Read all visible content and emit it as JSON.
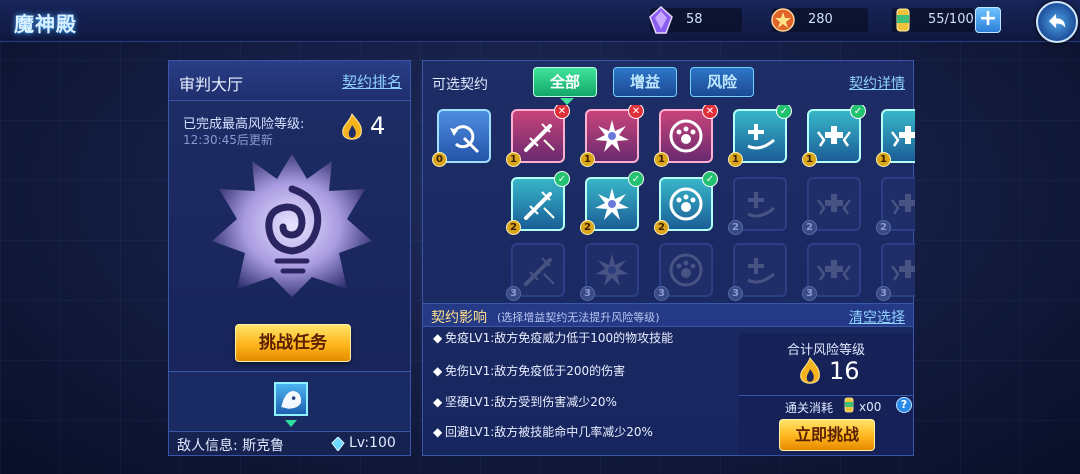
{
  "header": {
    "title": "魔神殿",
    "resources": [
      {
        "icon": "purple-crystal-icon",
        "value": "58"
      },
      {
        "icon": "medal-icon",
        "value": "280"
      },
      {
        "icon": "energy-can-icon",
        "value": "55/100"
      }
    ]
  },
  "left_panel": {
    "title": "审判大厅",
    "rank_link": "契约排名",
    "completed_label": "已完成最高风险等级:",
    "max_risk": "4",
    "update_text": "12:30:45后更新",
    "challenge_task_label": "挑战任务",
    "enemy_info": "敌人信息: 斯克鲁",
    "enemy_level": "Lv:100"
  },
  "right_panel": {
    "label": "可选契约",
    "tabs": [
      "全部",
      "增益",
      "风险"
    ],
    "active_tab": "全部",
    "detail_link": "契约详情",
    "cards_row1": [
      {
        "icon": "undo-sword-icon",
        "level": "0",
        "style": "blue",
        "mark": ""
      },
      {
        "icon": "sword-slash-icon",
        "level": "1",
        "style": "red",
        "mark": "x"
      },
      {
        "icon": "burst-icon",
        "level": "1",
        "style": "red",
        "mark": "x"
      },
      {
        "icon": "paw-shield-icon",
        "level": "1",
        "style": "red",
        "mark": "x"
      },
      {
        "icon": "heal-swirl-icon",
        "level": "1",
        "style": "teal",
        "mark": "ok"
      },
      {
        "icon": "wing-cross-icon",
        "level": "1",
        "style": "teal",
        "mark": "ok"
      },
      {
        "icon": "wing-cross-icon",
        "level": "1",
        "style": "teal",
        "mark": ""
      }
    ],
    "cards_row2": [
      {
        "icon": "sword-slash-icon",
        "level": "2",
        "style": "teal",
        "mark": "ok"
      },
      {
        "icon": "burst-icon",
        "level": "2",
        "style": "teal",
        "mark": "ok"
      },
      {
        "icon": "paw-shield-icon",
        "level": "2",
        "style": "teal",
        "mark": "ok"
      },
      {
        "icon": "heal-swirl-icon",
        "level": "2",
        "style": "locked",
        "mark": ""
      },
      {
        "icon": "wing-cross-icon",
        "level": "2",
        "style": "locked",
        "mark": ""
      },
      {
        "icon": "wing-cross-icon",
        "level": "2",
        "style": "locked",
        "mark": ""
      }
    ],
    "cards_row3": [
      {
        "icon": "sword-slash-icon",
        "level": "3",
        "style": "locked",
        "mark": ""
      },
      {
        "icon": "burst-icon",
        "level": "3",
        "style": "locked",
        "mark": ""
      },
      {
        "icon": "paw-shield-icon",
        "level": "3",
        "style": "locked",
        "mark": ""
      },
      {
        "icon": "heal-swirl-icon",
        "level": "3",
        "style": "locked",
        "mark": ""
      },
      {
        "icon": "wing-cross-icon",
        "level": "3",
        "style": "locked",
        "mark": ""
      },
      {
        "icon": "wing-cross-icon",
        "level": "3",
        "style": "locked",
        "mark": ""
      }
    ],
    "impact_title": "契约影响",
    "impact_note": "(选择增益契约无法提升风险等级)",
    "clear_link": "清空选择",
    "effects": [
      "免疫LV1:敌方免疫威力低于100的物攻技能",
      "免伤LV1:敌方免疫低于200的伤害",
      "坚硬LV1:敌方受到伤害减少20%",
      "回避LV1:敌方被技能命中几率减少20%"
    ],
    "risk_title": "合计风险等级",
    "risk_total": "16",
    "cost_label": "通关消耗",
    "cost_value": "x00",
    "help": "?",
    "challenge_now_label": "立即挑战"
  }
}
